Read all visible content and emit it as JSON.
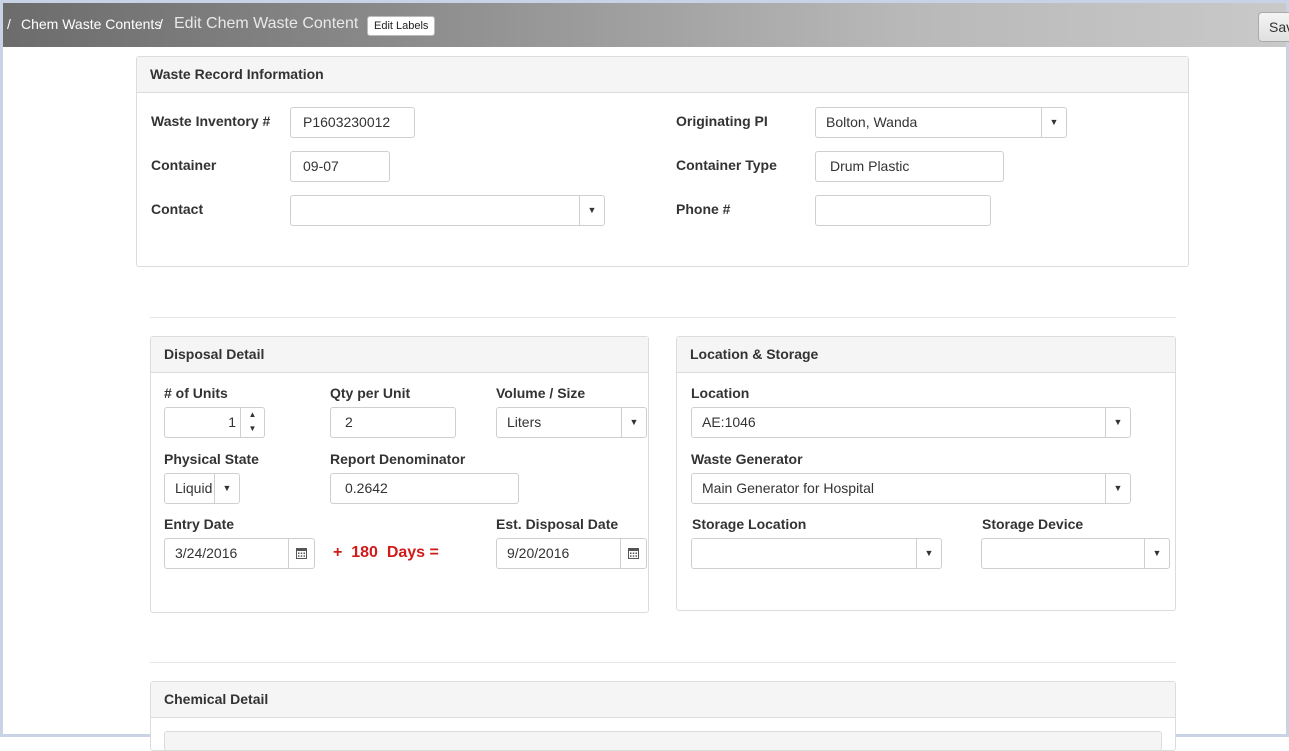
{
  "breadcrumb": {
    "sep1": "/",
    "link": "Chem Waste Contents",
    "sep2": "/",
    "current": "Edit Chem Waste Content"
  },
  "toolbar": {
    "edit_labels": "Edit Labels",
    "save_label": "Sav"
  },
  "waste_record": {
    "title": "Waste Record Information",
    "inventory_label": "Waste Inventory #",
    "inventory_value": "P1603230012",
    "container_label": "Container",
    "container_value": "09-07",
    "contact_label": "Contact",
    "contact_value": "",
    "pi_label": "Originating PI",
    "pi_value": "Bolton, Wanda",
    "container_type_label": "Container Type",
    "container_type_value": "Drum Plastic",
    "phone_label": "Phone #",
    "phone_value": ""
  },
  "disposal": {
    "title": "Disposal Detail",
    "units_label": "# of Units",
    "units_value": "1",
    "qty_label": "Qty per Unit",
    "qty_value": "2",
    "volume_label": "Volume / Size",
    "volume_value": "Liters",
    "state_label": "Physical State",
    "state_value": "Liquid",
    "denom_label": "Report Denominator",
    "denom_value": "0.2642",
    "entry_label": "Entry Date",
    "entry_value": "3/24/2016",
    "formula": "+  180  Days =",
    "disposal_label": "Est. Disposal Date",
    "disposal_value": "9/20/2016"
  },
  "location": {
    "title": "Location & Storage",
    "location_label": "Location",
    "location_value": "AE:1046",
    "generator_label": "Waste Generator",
    "generator_value": "Main Generator for Hospital",
    "storage_label": "Storage Location",
    "storage_value": "",
    "device_label": "Storage Device",
    "device_value": ""
  },
  "chemical": {
    "title": "Chemical Detail"
  },
  "icons": {
    "caret": "▼",
    "spin_up": "▲",
    "spin_down": "▼",
    "calendar": "calendar-icon"
  }
}
